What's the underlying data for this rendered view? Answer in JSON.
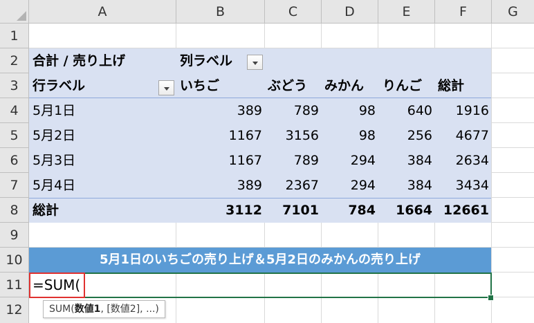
{
  "columns": [
    "A",
    "B",
    "C",
    "D",
    "E",
    "F",
    "G"
  ],
  "rows": [
    "1",
    "2",
    "3",
    "4",
    "5",
    "6",
    "7",
    "8",
    "9",
    "10",
    "11",
    "12"
  ],
  "pivot": {
    "value_label": "合計 / 売り上げ",
    "col_label": "列ラベル",
    "row_label": "行ラベル",
    "headers": [
      "いちご",
      "ぶどう",
      "みかん",
      "りんご",
      "総計"
    ],
    "data": [
      {
        "label": "5月1日",
        "values": [
          "389",
          "789",
          "98",
          "640",
          "1916"
        ]
      },
      {
        "label": "5月2日",
        "values": [
          "1167",
          "3156",
          "98",
          "256",
          "4677"
        ]
      },
      {
        "label": "5月3日",
        "values": [
          "1167",
          "789",
          "294",
          "384",
          "2634"
        ]
      },
      {
        "label": "5月4日",
        "values": [
          "389",
          "2367",
          "294",
          "384",
          "3434"
        ]
      }
    ],
    "total": {
      "label": "総計",
      "values": [
        "3112",
        "7101",
        "784",
        "1664",
        "12661"
      ]
    }
  },
  "banner": "5月1日のいちごの売り上げ＆5月2日のみかんの売り上げ",
  "formula_cell": "=SUM(",
  "tooltip": {
    "func": "SUM(",
    "arg1": "数値1",
    "rest": ", [数値2], ...)"
  },
  "colors": {
    "pivot_fill": "#d9e1f2",
    "banner_fill": "#5b9bd5",
    "active_border": "#217346",
    "highlight": "#e0312f"
  }
}
